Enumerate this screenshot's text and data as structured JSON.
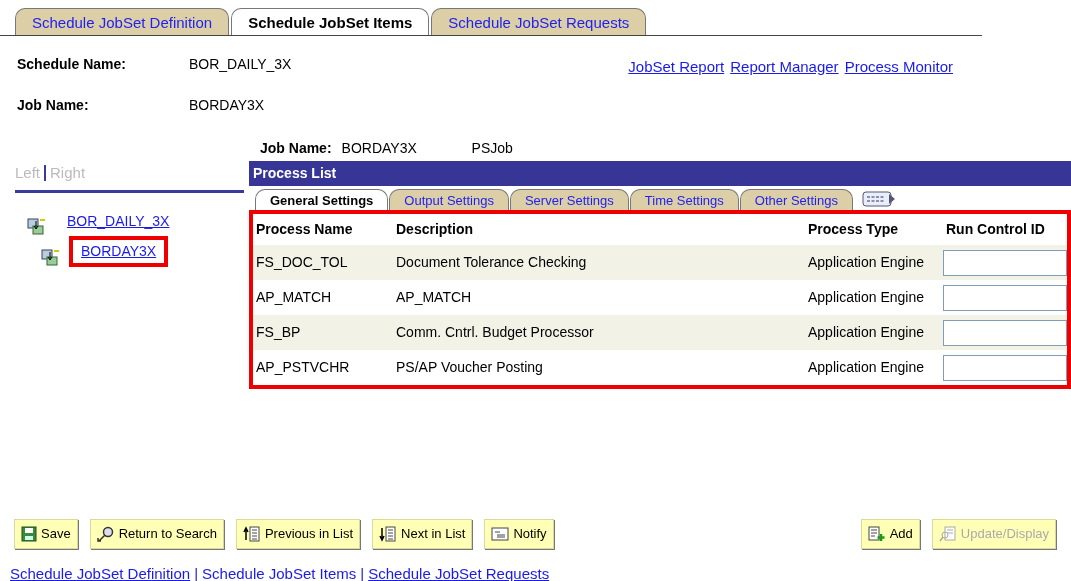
{
  "page_tabs": [
    {
      "label": "Schedule JobSet Definition",
      "selected": false
    },
    {
      "label": "Schedule JobSet Items",
      "selected": true
    },
    {
      "label": "Schedule JobSet Requests",
      "selected": false
    }
  ],
  "header_fields": [
    {
      "label": "Schedule Name:",
      "value": "BOR_DAILY_3X"
    },
    {
      "label": "Job Name:",
      "value": "BORDAY3X"
    }
  ],
  "header_links": [
    "JobSet Report",
    "Report Manager",
    "Process Monitor"
  ],
  "view_toggle": [
    {
      "label": "Left",
      "disabled": true
    },
    {
      "label": "Right",
      "disabled": true
    }
  ],
  "tree": [
    {
      "label": "BOR_DAILY_3X",
      "highlighted": false,
      "children": [
        {
          "label": "BORDAY3X",
          "highlighted": true
        }
      ]
    }
  ],
  "job": {
    "label": "Job Name:",
    "value": "BORDAY3X",
    "type": "PSJob"
  },
  "process_list": {
    "title": "Process List",
    "tabs": [
      {
        "label": "General Settings",
        "selected": true
      },
      {
        "label": "Output Settings",
        "selected": false
      },
      {
        "label": "Server Settings",
        "selected": false
      },
      {
        "label": "Time Settings",
        "selected": false
      },
      {
        "label": "Other Settings",
        "selected": false
      }
    ],
    "highlighted": true,
    "columns": [
      "Process Name",
      "Description",
      "Process Type",
      "Run Control ID"
    ],
    "rows": [
      {
        "process_name": "FS_DOC_TOL",
        "description": "Document Tolerance Checking",
        "process_type": "Application Engine"
      },
      {
        "process_name": "AP_MATCH",
        "description": "AP_MATCH",
        "process_type": "Application Engine"
      },
      {
        "process_name": "FS_BP",
        "description": "Comm. Cntrl. Budget Processor",
        "process_type": "Application Engine"
      },
      {
        "process_name": "AP_PSTVCHR",
        "description": "PS/AP Voucher Posting",
        "process_type": "Application Engine"
      }
    ]
  },
  "buttons_left": [
    {
      "kind": "save",
      "label": "Save",
      "disabled": false
    },
    {
      "kind": "search",
      "label": "Return to Search",
      "disabled": false
    },
    {
      "kind": "previous",
      "label": "Previous in List",
      "disabled": false
    },
    {
      "kind": "next",
      "label": "Next in List",
      "disabled": false
    },
    {
      "kind": "notify",
      "label": "Notify",
      "disabled": false
    }
  ],
  "buttons_right": [
    {
      "kind": "add",
      "label": "Add",
      "disabled": false
    },
    {
      "kind": "update",
      "label": "Update/Display",
      "disabled": true
    }
  ],
  "footer_links": [
    {
      "label": "Schedule JobSet Definition",
      "selected": false
    },
    {
      "label": "Schedule JobSet Items",
      "selected": true
    },
    {
      "label": "Schedule JobSet Requests",
      "selected": false
    }
  ],
  "footer_separators": [
    "|",
    "|"
  ]
}
